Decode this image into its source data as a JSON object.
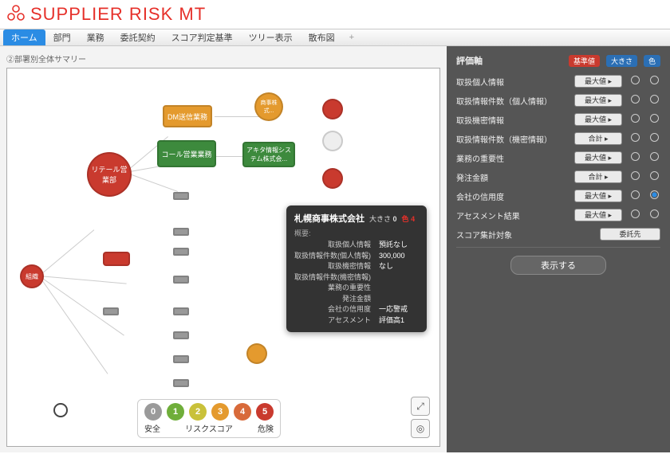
{
  "app": {
    "title": "SUPPLIER RISK MT"
  },
  "tabs": [
    {
      "label": "ホーム",
      "active": true
    },
    {
      "label": "部門"
    },
    {
      "label": "業務"
    },
    {
      "label": "委託契約"
    },
    {
      "label": "スコア判定基準"
    },
    {
      "label": "ツリー表示"
    },
    {
      "label": "散布図"
    }
  ],
  "canvas": {
    "title": "②部署別全体サマリー"
  },
  "nodes": {
    "root": "組織",
    "retail": "リテール営業部",
    "dm": "DM送信業務",
    "call": "コール営業業務",
    "akita": "アキタ情報システム株式会...",
    "shoji": "商事株式..."
  },
  "tooltip": {
    "title": "札幌商事株式会社",
    "size_label": "大きさ",
    "size_value": "0",
    "color_label": "色",
    "color_value": "4",
    "summary_label": "概要:",
    "rows": [
      {
        "k": "取扱個人情報",
        "v": "預託なし"
      },
      {
        "k": "取扱情報件数(個人情報)",
        "v": "300,000"
      },
      {
        "k": "取扱機密情報",
        "v": "なし"
      },
      {
        "k": "取扱情報件数(機密情報)",
        "v": ""
      },
      {
        "k": "業務の重要性",
        "v": ""
      },
      {
        "k": "発注金額",
        "v": ""
      },
      {
        "k": "会社の信用度",
        "v": "一応警戒"
      },
      {
        "k": "アセスメント",
        "v": "評価高1"
      }
    ]
  },
  "legend": {
    "scores": [
      {
        "n": "0",
        "c": "#9a9a9a"
      },
      {
        "n": "1",
        "c": "#6fae3a"
      },
      {
        "n": "2",
        "c": "#c9c13a"
      },
      {
        "n": "3",
        "c": "#e49a2e"
      },
      {
        "n": "4",
        "c": "#d86a3a"
      },
      {
        "n": "5",
        "c": "#c93a2e"
      }
    ],
    "left": "安全",
    "center": "リスクスコア",
    "right": "危険"
  },
  "side": {
    "header": {
      "axis": "評価軸",
      "base": "基準値",
      "size": "大きさ",
      "color": "色"
    },
    "rows": [
      {
        "name": "取扱個人情報",
        "sel": "最大値",
        "size": false,
        "color": true
      },
      {
        "name": "取扱情報件数（個人情報）",
        "sel": "最大値",
        "size": false,
        "color": false
      },
      {
        "name": "取扱機密情報",
        "sel": "最大値",
        "size": false,
        "color": false
      },
      {
        "name": "取扱情報件数（機密情報）",
        "sel": "合計",
        "size": false,
        "color": false
      },
      {
        "name": "業務の重要性",
        "sel": "最大値",
        "size": false,
        "color": false
      },
      {
        "name": "発注金額",
        "sel": "合計",
        "size": false,
        "color": false
      },
      {
        "name": "会社の信用度",
        "sel": "最大値",
        "size": false,
        "color": true
      },
      {
        "name": "アセスメント結果",
        "sel": "最大値",
        "size": false,
        "color": false
      }
    ],
    "aggregate": {
      "label": "スコア集計対象",
      "sel": "委託先"
    },
    "button": "表示する"
  }
}
